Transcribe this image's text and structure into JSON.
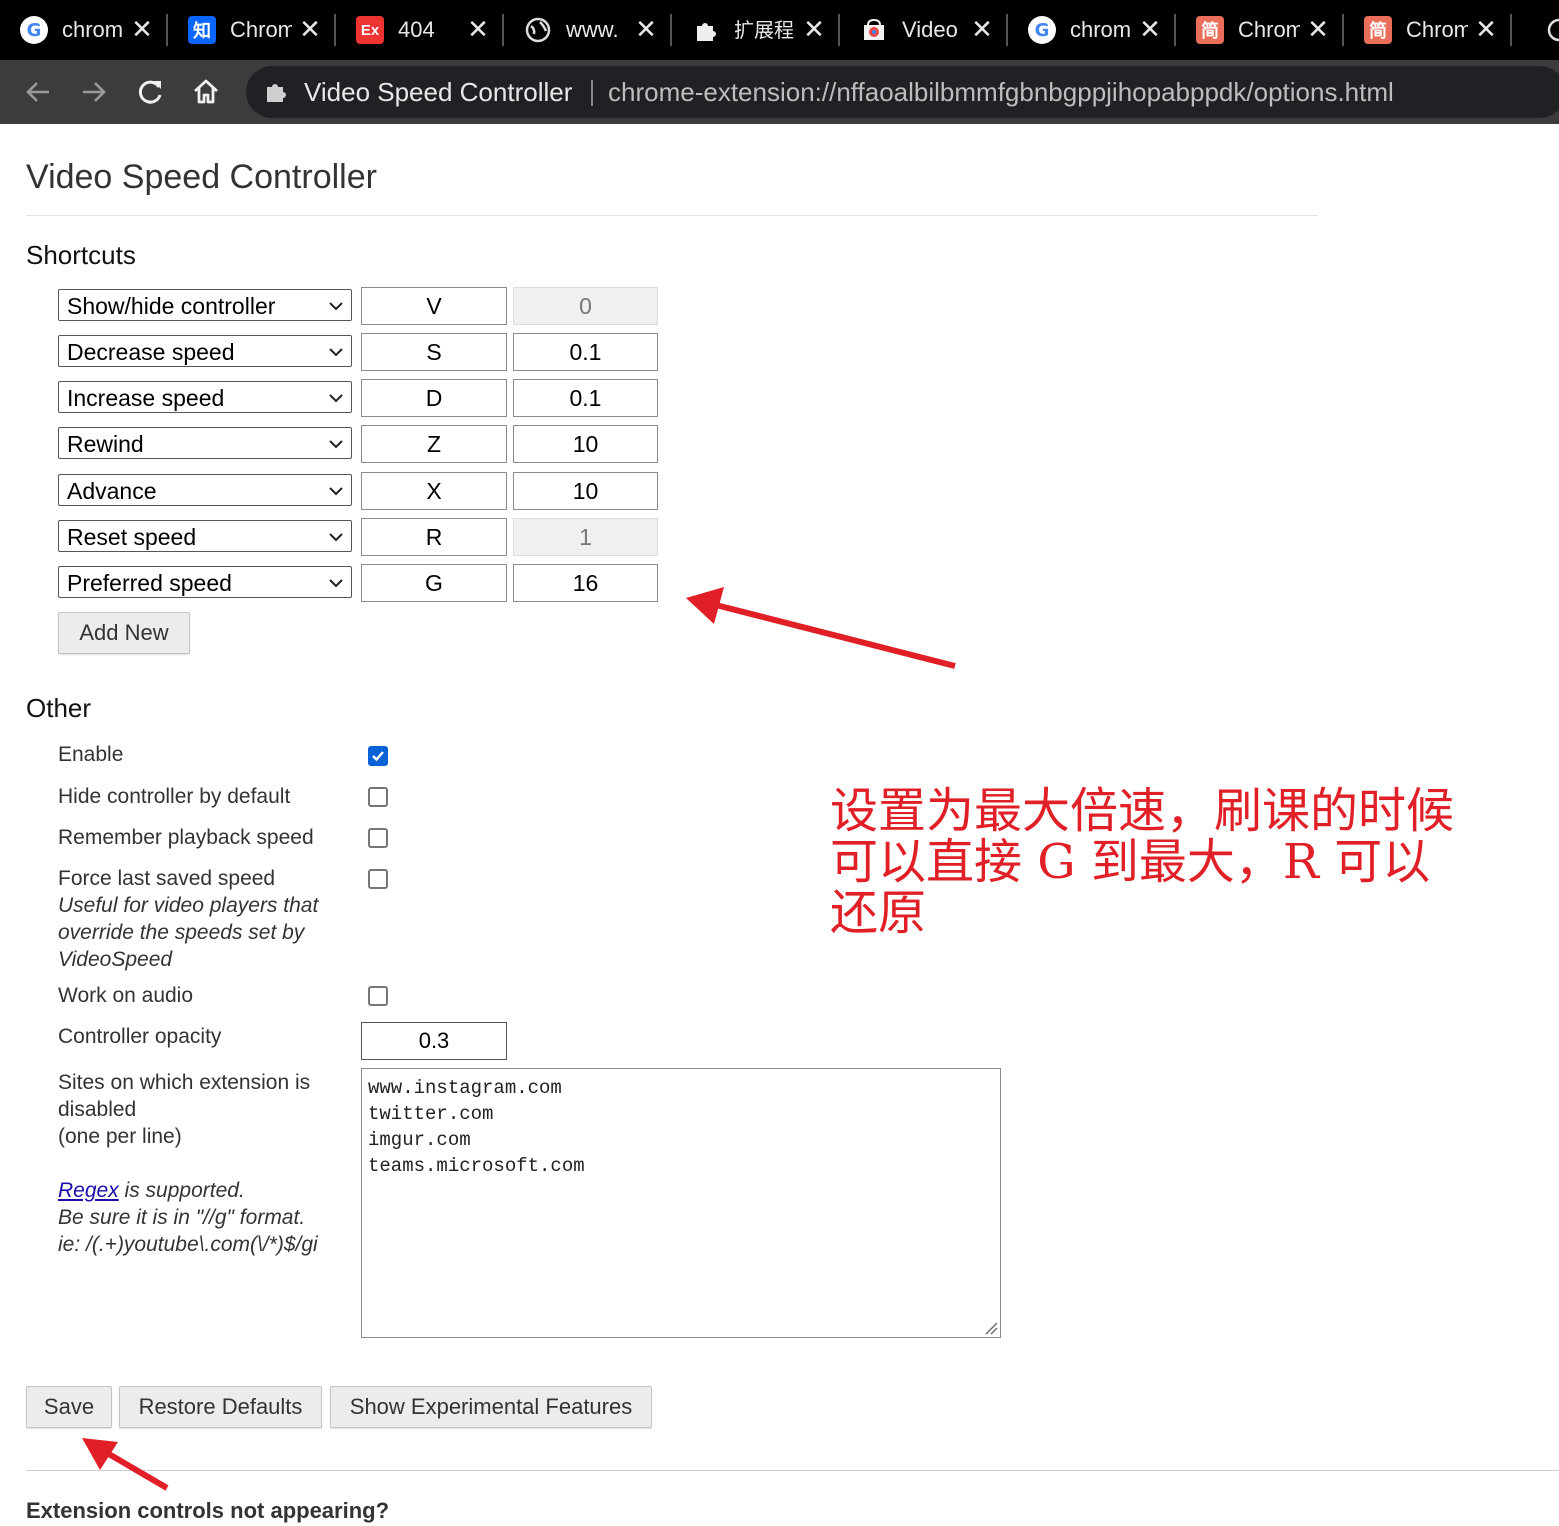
{
  "tabs": [
    {
      "icon": "google-icon",
      "title": "chrom"
    },
    {
      "icon": "zhihu-icon",
      "title": "Chrom"
    },
    {
      "icon": "ex-icon",
      "title": "404"
    },
    {
      "icon": "globe-icon",
      "title": "www."
    },
    {
      "icon": "puzzle-icon",
      "title": "扩展程"
    },
    {
      "icon": "webstore-icon",
      "title": "Video"
    },
    {
      "icon": "google-icon",
      "title": "chrom"
    },
    {
      "icon": "jianshu-icon",
      "title": "Chrom"
    },
    {
      "icon": "jianshu-icon",
      "title": "Chrom"
    }
  ],
  "tab_icon_glyphs": {
    "zhihu": "知",
    "ex": "Ex",
    "jianshu": "简",
    "google": "G"
  },
  "omnibox": {
    "site_name": "Video Speed Controller",
    "url": "chrome-extension://nffaoalbilbmmfgbnbgppjihopabppdk/options.html"
  },
  "page_title": "Video Speed Controller",
  "shortcuts": {
    "title": "Shortcuts",
    "rows": [
      {
        "action": "Show/hide controller",
        "key": "V",
        "value": "0",
        "value_disabled": true
      },
      {
        "action": "Decrease speed",
        "key": "S",
        "value": "0.1",
        "value_disabled": false
      },
      {
        "action": "Increase speed",
        "key": "D",
        "value": "0.1",
        "value_disabled": false
      },
      {
        "action": "Rewind",
        "key": "Z",
        "value": "10",
        "value_disabled": false
      },
      {
        "action": "Advance",
        "key": "X",
        "value": "10",
        "value_disabled": false
      },
      {
        "action": "Reset speed",
        "key": "R",
        "value": "1",
        "value_disabled": true
      },
      {
        "action": "Preferred speed",
        "key": "G",
        "value": "16",
        "value_disabled": false
      }
    ],
    "add_new_label": "Add New"
  },
  "other": {
    "title": "Other",
    "enable": {
      "label": "Enable",
      "checked": true
    },
    "hide_controller": {
      "label": "Hide controller by default",
      "checked": false
    },
    "remember_speed": {
      "label": "Remember playback speed",
      "checked": false
    },
    "force_last": {
      "label": "Force last saved speed",
      "checked": false,
      "desc_1": "Useful for video players that",
      "desc_2": "override the speeds set by",
      "desc_3": "VideoSpeed"
    },
    "work_on_audio": {
      "label": "Work on audio",
      "checked": false
    },
    "opacity": {
      "label": "Controller opacity",
      "value": "0.3"
    },
    "sites": {
      "label_1": "Sites on which extension is",
      "label_2": "disabled",
      "label_3": "(one per line)",
      "regex_link": "Regex",
      "regex_rest": " is supported.",
      "format_line": "Be sure it is in \"//g\" format.",
      "example_line": "ie: /(.+)youtube\\.com(\\/*)$/gi",
      "values": [
        "www.instagram.com",
        "twitter.com",
        "imgur.com",
        "teams.microsoft.com"
      ]
    }
  },
  "buttons": {
    "save": "Save",
    "restore": "Restore Defaults",
    "experimental": "Show Experimental Features"
  },
  "footer_heading": "Extension controls not appearing?",
  "annotation": {
    "line_1": "设置为最大倍速，刷课的时候",
    "line_2": "可以直接 G 到最大，R 可以",
    "line_3": "还原",
    "color": "#e01f26"
  },
  "colors": {
    "accent": "#0b62d6",
    "link": "#1a0dab",
    "annotation_red": "#e01f26",
    "tabstrip": "#000000",
    "toolbar": "#3c3c3c"
  }
}
